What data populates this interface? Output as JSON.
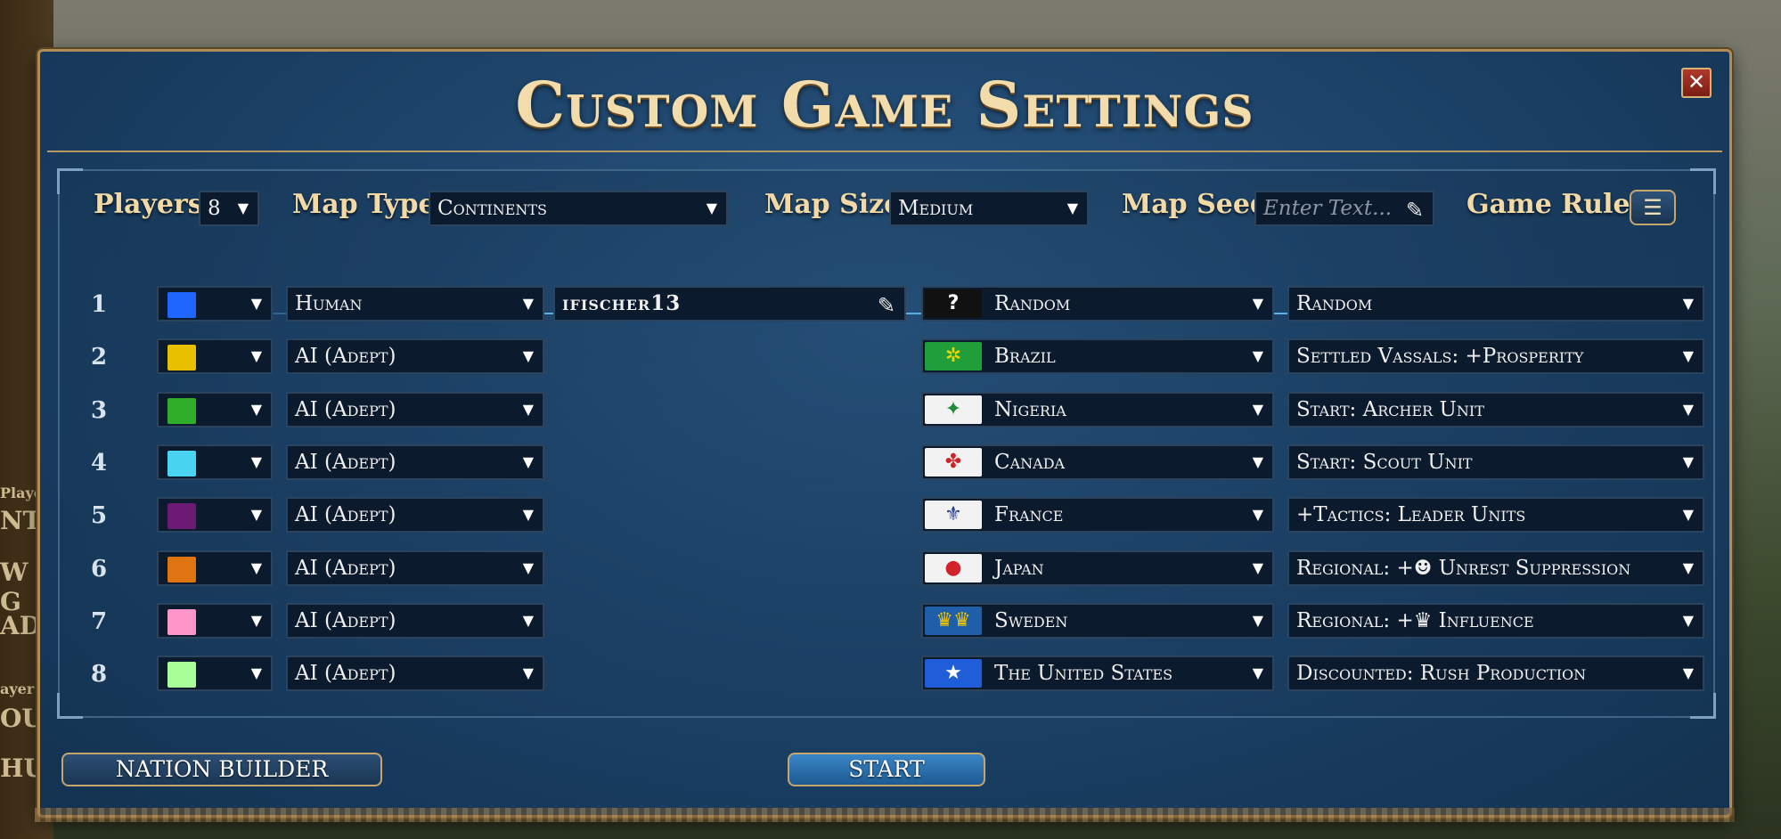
{
  "background_text": [
    "Player",
    "NTI",
    "W G",
    "AD",
    "ayer",
    "OUI",
    "HUI"
  ],
  "dialog": {
    "title": "Custom Game Settings",
    "close_icon": "close-icon"
  },
  "settings": {
    "players_label": "Players",
    "players_value": "8",
    "map_type_label": "Map Type",
    "map_type_value": "Continents",
    "map_size_label": "Map Size",
    "map_size_value": "Medium",
    "map_seed_label": "Map Seed",
    "map_seed_placeholder": "Enter Text...",
    "game_rules_label": "Game Rules"
  },
  "players": [
    {
      "num": "1",
      "color": "#1e66ff",
      "type": "Human",
      "name": "ifischer13",
      "nation": "Random",
      "flag_bg": "#111111",
      "flag_glyph": "?",
      "flag_fg": "#ffffff",
      "bonus": "Random"
    },
    {
      "num": "2",
      "color": "#e8c000",
      "type": "AI (Adept)",
      "name": "",
      "nation": "Brazil",
      "flag_bg": "#1f9e3a",
      "flag_glyph": "✲",
      "flag_fg": "#f2d400",
      "bonus": "Settled Vassals: +Prosperity"
    },
    {
      "num": "3",
      "color": "#2fae2a",
      "type": "AI (Adept)",
      "name": "",
      "nation": "Nigeria",
      "flag_bg": "#f2f2f2",
      "flag_glyph": "✦",
      "flag_fg": "#1f8a3a",
      "bonus": "Start: Archer Unit"
    },
    {
      "num": "4",
      "color": "#49d4f2",
      "type": "AI (Adept)",
      "name": "",
      "nation": "Canada",
      "flag_bg": "#f2f2f2",
      "flag_glyph": "✤",
      "flag_fg": "#d2232a",
      "bonus": "Start: Scout Unit"
    },
    {
      "num": "5",
      "color": "#6d1a74",
      "type": "AI (Adept)",
      "name": "",
      "nation": "France",
      "flag_bg": "#f2f2f2",
      "flag_glyph": "⚜",
      "flag_fg": "#23408f",
      "bonus": "+Tactics: Leader Units"
    },
    {
      "num": "6",
      "color": "#e07410",
      "type": "AI (Adept)",
      "name": "",
      "nation": "Japan",
      "flag_bg": "#f2f2f2",
      "flag_glyph": "●",
      "flag_fg": "#d2232a",
      "bonus": "Regional: +☻ Unrest Suppression"
    },
    {
      "num": "7",
      "color": "#ff95c8",
      "type": "AI (Adept)",
      "name": "",
      "nation": "Sweden",
      "flag_bg": "#1f5ea8",
      "flag_glyph": "♛♛",
      "flag_fg": "#f2c400",
      "bonus": "Regional: +♛ Influence"
    },
    {
      "num": "8",
      "color": "#a8ff98",
      "type": "AI (Adept)",
      "name": "",
      "nation": "The United States",
      "flag_bg": "#1f5ed8",
      "flag_glyph": "★",
      "flag_fg": "#ffffff",
      "bonus": "Discounted: Rush Production"
    }
  ],
  "buttons": {
    "nation_builder": "NATION BUILDER",
    "start": "START"
  }
}
